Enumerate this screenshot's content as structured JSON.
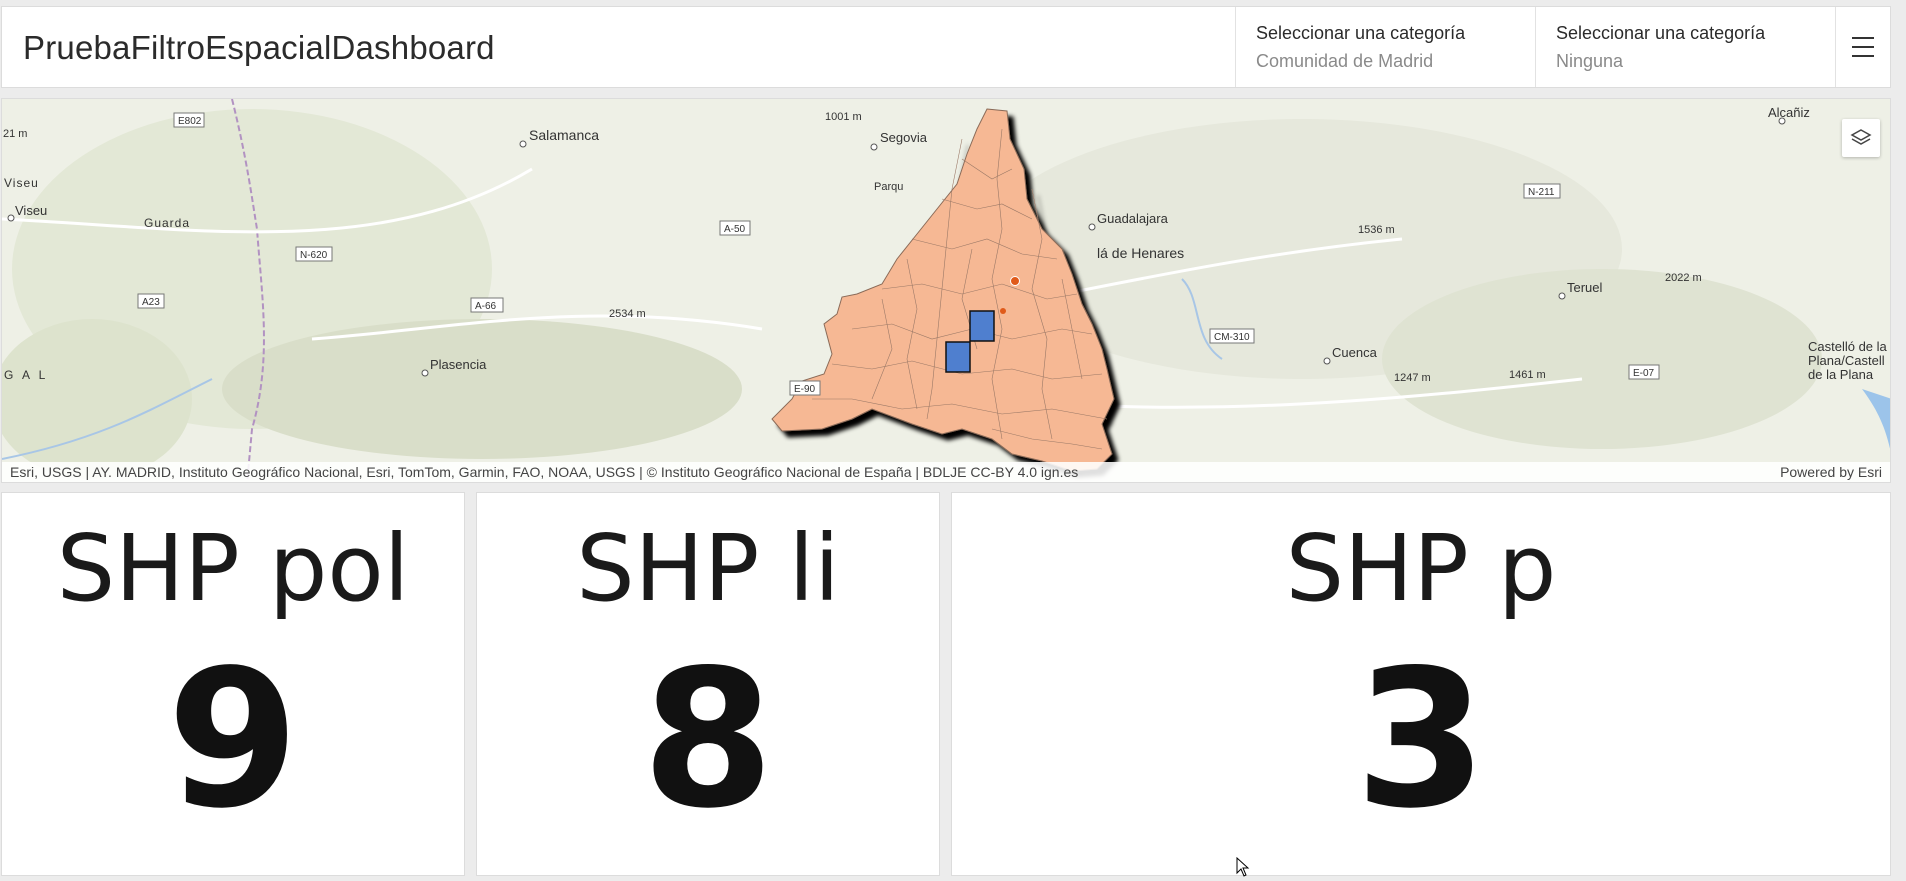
{
  "header": {
    "title": "PruebaFiltroEspacialDashboard",
    "selectors": [
      {
        "label": "Seleccionar una categoría",
        "value": "Comunidad de Madrid"
      },
      {
        "label": "Seleccionar una categoría",
        "value": "Ninguna"
      }
    ],
    "menu_icon": "hamburger-icon"
  },
  "map": {
    "layers_icon": "layers-icon",
    "labels": {
      "salamanca": "Salamanca",
      "segovia": "Segovia",
      "guadalajara": "Guadalajara",
      "alcala": "lá de Henares",
      "viseu1": "Viseu",
      "viseu2": "Viseu",
      "guarda": "Guarda",
      "plasencia": "Plasencia",
      "teruel": "Teruel",
      "cuenca": "Cuenca",
      "alcaniz": "Alcañiz",
      "castello1": "Castelló de la",
      "castello2": "Plana/Castell",
      "castello3": "de la Plana",
      "parque": "Parqu",
      "gal": "G A L"
    },
    "peaks": [
      "1001 m",
      "1536 m",
      "2022 m",
      "2534 m",
      "1247 m",
      "1461 m",
      "21 m"
    ],
    "roads": [
      "E802",
      "N-620",
      "A23",
      "A-66",
      "A-50",
      "E-90",
      "N-211",
      "CM-310",
      "E-07"
    ],
    "attribution": "Esri, USGS | AY. MADRID, Instituto Geográfico Nacional, Esri, TomTom, Garmin, FAO, NOAA, USGS | © Instituto Geográfico Nacional de España | BDLJE CC-BY 4.0 ign.es",
    "powered_by": "Powered by Esri",
    "colors": {
      "region_fill": "#f6b894",
      "polygon_fill": "#4f7fcf",
      "point": "#e05a1a"
    }
  },
  "counters": [
    {
      "title": "SHP pol",
      "value": "9"
    },
    {
      "title": "SHP li",
      "value": "8"
    },
    {
      "title": "SHP p",
      "value": "3"
    }
  ]
}
